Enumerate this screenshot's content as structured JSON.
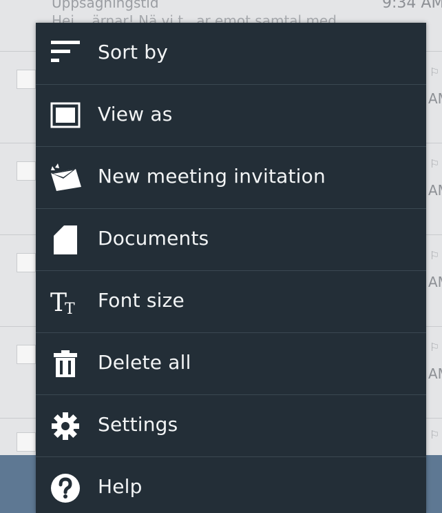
{
  "background": {
    "header": {
      "subject": "Uppsägningstid",
      "preview": "Hej ...ärnar! Nä vi t...ar emot samtal med",
      "time": "9:34 AM"
    },
    "row_time_fragment": "AM"
  },
  "menu": {
    "items": [
      {
        "key": "sort-by",
        "label": "Sort by",
        "icon": "sort-icon"
      },
      {
        "key": "view-as",
        "label": "View as",
        "icon": "view-as-icon"
      },
      {
        "key": "new-meeting-invitation",
        "label": "New meeting invitation",
        "icon": "meeting-invitation-icon"
      },
      {
        "key": "documents",
        "label": "Documents",
        "icon": "document-icon"
      },
      {
        "key": "font-size",
        "label": "Font size",
        "icon": "font-size-icon"
      },
      {
        "key": "delete-all",
        "label": "Delete all",
        "icon": "trash-icon"
      },
      {
        "key": "settings",
        "label": "Settings",
        "icon": "gear-icon"
      },
      {
        "key": "help",
        "label": "Help",
        "icon": "help-icon"
      }
    ]
  },
  "colors": {
    "menu_background": "#232e37",
    "menu_divider": "#3b4852",
    "menu_text": "#f2f4f5",
    "background_list": "#e4e5e7",
    "bottom_bar": "#5e7893"
  }
}
